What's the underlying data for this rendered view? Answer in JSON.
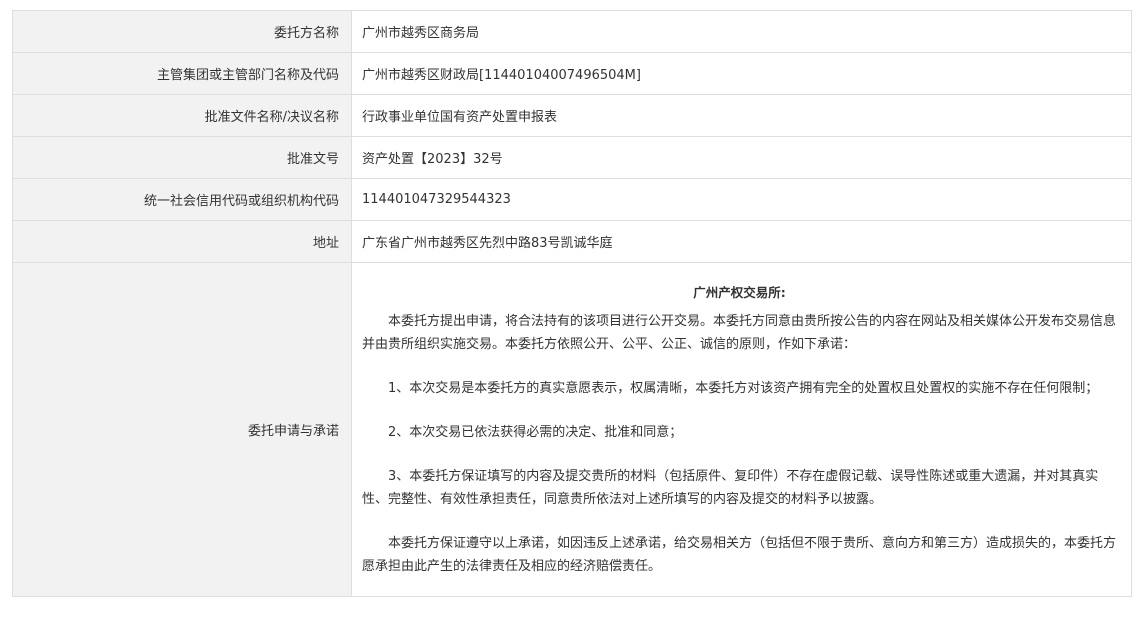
{
  "rows": [
    {
      "label": "委托方名称",
      "value": "广州市越秀区商务局"
    },
    {
      "label": "主管集团或主管部门名称及代码",
      "value": "广州市越秀区财政局[11440104007496504M]"
    },
    {
      "label": "批准文件名称/决议名称",
      "value": "行政事业单位国有资产处置申报表"
    },
    {
      "label": "批准文号",
      "value": "资产处置【2023】32号"
    },
    {
      "label": "统一社会信用代码或组织机构代码",
      "value": "114401047329544323"
    },
    {
      "label": "地址",
      "value": "广东省广州市越秀区先烈中路83号凯诚华庭"
    }
  ],
  "commitment": {
    "label": "委托申请与承诺",
    "heading": "广州产权交易所:",
    "paragraphs": [
      "本委托方提出申请，将合法持有的该项目进行公开交易。本委托方同意由贵所按公告的内容在网站及相关媒体公开发布交易信息并由贵所组织实施交易。本委托方依照公开、公平、公正、诚信的原则，作如下承诺：",
      "1、本次交易是本委托方的真实意愿表示，权属清晰，本委托方对该资产拥有完全的处置权且处置权的实施不存在任何限制；",
      "2、本次交易已依法获得必需的决定、批准和同意；",
      "3、本委托方保证填写的内容及提交贵所的材料（包括原件、复印件）不存在虚假记载、误导性陈述或重大遗漏，并对其真实性、完整性、有效性承担责任，同意贵所依法对上述所填写的内容及提交的材料予以披露。",
      "本委托方保证遵守以上承诺，如因违反上述承诺，给交易相关方（包括但不限于贵所、意向方和第三方）造成损失的，本委托方愿承担由此产生的法律责任及相应的经济赔偿责任。"
    ]
  }
}
